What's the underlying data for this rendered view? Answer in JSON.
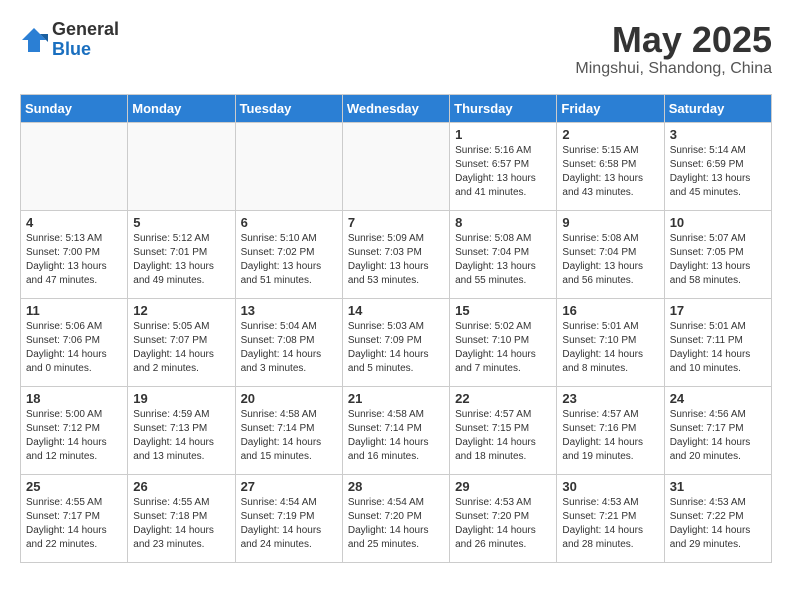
{
  "logo": {
    "general": "General",
    "blue": "Blue"
  },
  "title": "May 2025",
  "subtitle": "Mingshui, Shandong, China",
  "days_of_week": [
    "Sunday",
    "Monday",
    "Tuesday",
    "Wednesday",
    "Thursday",
    "Friday",
    "Saturday"
  ],
  "weeks": [
    [
      {
        "day": "",
        "info": ""
      },
      {
        "day": "",
        "info": ""
      },
      {
        "day": "",
        "info": ""
      },
      {
        "day": "",
        "info": ""
      },
      {
        "day": "1",
        "info": "Sunrise: 5:16 AM\nSunset: 6:57 PM\nDaylight: 13 hours\nand 41 minutes."
      },
      {
        "day": "2",
        "info": "Sunrise: 5:15 AM\nSunset: 6:58 PM\nDaylight: 13 hours\nand 43 minutes."
      },
      {
        "day": "3",
        "info": "Sunrise: 5:14 AM\nSunset: 6:59 PM\nDaylight: 13 hours\nand 45 minutes."
      }
    ],
    [
      {
        "day": "4",
        "info": "Sunrise: 5:13 AM\nSunset: 7:00 PM\nDaylight: 13 hours\nand 47 minutes."
      },
      {
        "day": "5",
        "info": "Sunrise: 5:12 AM\nSunset: 7:01 PM\nDaylight: 13 hours\nand 49 minutes."
      },
      {
        "day": "6",
        "info": "Sunrise: 5:10 AM\nSunset: 7:02 PM\nDaylight: 13 hours\nand 51 minutes."
      },
      {
        "day": "7",
        "info": "Sunrise: 5:09 AM\nSunset: 7:03 PM\nDaylight: 13 hours\nand 53 minutes."
      },
      {
        "day": "8",
        "info": "Sunrise: 5:08 AM\nSunset: 7:04 PM\nDaylight: 13 hours\nand 55 minutes."
      },
      {
        "day": "9",
        "info": "Sunrise: 5:08 AM\nSunset: 7:04 PM\nDaylight: 13 hours\nand 56 minutes."
      },
      {
        "day": "10",
        "info": "Sunrise: 5:07 AM\nSunset: 7:05 PM\nDaylight: 13 hours\nand 58 minutes."
      }
    ],
    [
      {
        "day": "11",
        "info": "Sunrise: 5:06 AM\nSunset: 7:06 PM\nDaylight: 14 hours\nand 0 minutes."
      },
      {
        "day": "12",
        "info": "Sunrise: 5:05 AM\nSunset: 7:07 PM\nDaylight: 14 hours\nand 2 minutes."
      },
      {
        "day": "13",
        "info": "Sunrise: 5:04 AM\nSunset: 7:08 PM\nDaylight: 14 hours\nand 3 minutes."
      },
      {
        "day": "14",
        "info": "Sunrise: 5:03 AM\nSunset: 7:09 PM\nDaylight: 14 hours\nand 5 minutes."
      },
      {
        "day": "15",
        "info": "Sunrise: 5:02 AM\nSunset: 7:10 PM\nDaylight: 14 hours\nand 7 minutes."
      },
      {
        "day": "16",
        "info": "Sunrise: 5:01 AM\nSunset: 7:10 PM\nDaylight: 14 hours\nand 8 minutes."
      },
      {
        "day": "17",
        "info": "Sunrise: 5:01 AM\nSunset: 7:11 PM\nDaylight: 14 hours\nand 10 minutes."
      }
    ],
    [
      {
        "day": "18",
        "info": "Sunrise: 5:00 AM\nSunset: 7:12 PM\nDaylight: 14 hours\nand 12 minutes."
      },
      {
        "day": "19",
        "info": "Sunrise: 4:59 AM\nSunset: 7:13 PM\nDaylight: 14 hours\nand 13 minutes."
      },
      {
        "day": "20",
        "info": "Sunrise: 4:58 AM\nSunset: 7:14 PM\nDaylight: 14 hours\nand 15 minutes."
      },
      {
        "day": "21",
        "info": "Sunrise: 4:58 AM\nSunset: 7:14 PM\nDaylight: 14 hours\nand 16 minutes."
      },
      {
        "day": "22",
        "info": "Sunrise: 4:57 AM\nSunset: 7:15 PM\nDaylight: 14 hours\nand 18 minutes."
      },
      {
        "day": "23",
        "info": "Sunrise: 4:57 AM\nSunset: 7:16 PM\nDaylight: 14 hours\nand 19 minutes."
      },
      {
        "day": "24",
        "info": "Sunrise: 4:56 AM\nSunset: 7:17 PM\nDaylight: 14 hours\nand 20 minutes."
      }
    ],
    [
      {
        "day": "25",
        "info": "Sunrise: 4:55 AM\nSunset: 7:17 PM\nDaylight: 14 hours\nand 22 minutes."
      },
      {
        "day": "26",
        "info": "Sunrise: 4:55 AM\nSunset: 7:18 PM\nDaylight: 14 hours\nand 23 minutes."
      },
      {
        "day": "27",
        "info": "Sunrise: 4:54 AM\nSunset: 7:19 PM\nDaylight: 14 hours\nand 24 minutes."
      },
      {
        "day": "28",
        "info": "Sunrise: 4:54 AM\nSunset: 7:20 PM\nDaylight: 14 hours\nand 25 minutes."
      },
      {
        "day": "29",
        "info": "Sunrise: 4:53 AM\nSunset: 7:20 PM\nDaylight: 14 hours\nand 26 minutes."
      },
      {
        "day": "30",
        "info": "Sunrise: 4:53 AM\nSunset: 7:21 PM\nDaylight: 14 hours\nand 28 minutes."
      },
      {
        "day": "31",
        "info": "Sunrise: 4:53 AM\nSunset: 7:22 PM\nDaylight: 14 hours\nand 29 minutes."
      }
    ]
  ]
}
